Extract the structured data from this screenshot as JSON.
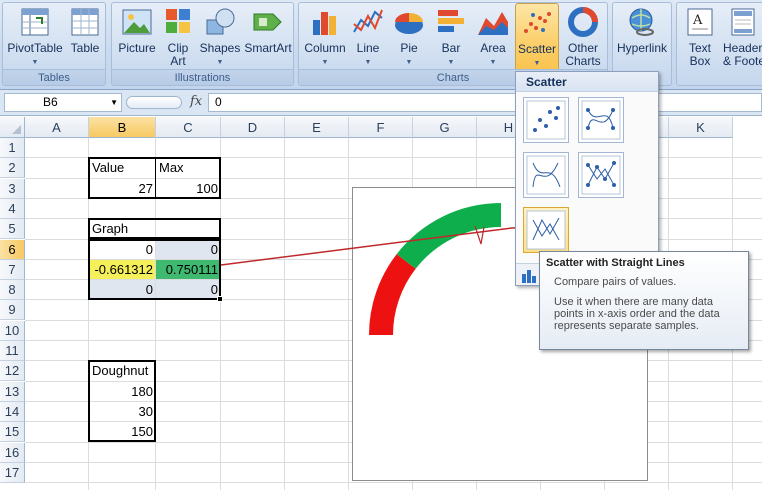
{
  "ribbon": {
    "tables": {
      "label": "Tables",
      "pivottable": "PivotTable",
      "table": "Table"
    },
    "illustrations": {
      "label": "Illustrations",
      "picture": "Picture",
      "clip_art_1": "Clip",
      "clip_art_2": "Art",
      "shapes": "Shapes",
      "smartart": "SmartArt"
    },
    "charts": {
      "label": "Charts",
      "column": "Column",
      "line": "Line",
      "pie": "Pie",
      "bar": "Bar",
      "area": "Area",
      "scatter": "Scatter",
      "other_1": "Other",
      "other_2": "Charts"
    },
    "links": {
      "hyperlink": "Hyperlink"
    },
    "text": {
      "textbox_1": "Text",
      "textbox_2": "Box",
      "header_1": "Header",
      "header_2": "& Foote"
    }
  },
  "formula_bar": {
    "name_box": "B6",
    "fx": "fx",
    "value": "0"
  },
  "columns": [
    "A",
    "B",
    "C",
    "D",
    "E",
    "F",
    "G",
    "H",
    "I",
    "J",
    "K"
  ],
  "rows": [
    "1",
    "2",
    "3",
    "4",
    "5",
    "6",
    "7",
    "8",
    "9",
    "10",
    "11",
    "12",
    "13",
    "14",
    "15",
    "16",
    "17"
  ],
  "cells": {
    "B2": "Value",
    "C2": "Max",
    "B3": "27",
    "C3": "100",
    "B5": "Graph",
    "B6": "0",
    "C6": "0",
    "B7": "-0.661312",
    "C7": "0.750111",
    "B8": "0",
    "C8": "0",
    "B12": "Doughnut",
    "B13": "180",
    "B14": "30",
    "B15": "150"
  },
  "chart": {
    "gauge_value": 27,
    "gauge_max": 100,
    "colors": {
      "red": "#ee1111",
      "green": "#0fae4c",
      "needle": "#c0282a"
    }
  },
  "dropdown": {
    "title": "Scatter"
  },
  "tooltip": {
    "title": "Scatter with Straight Lines",
    "desc": "Compare pairs of values.",
    "detail": "Use it when there are many data points in x-axis order and the data represents separate samples."
  },
  "colors": {
    "selection_fill": "#f7c961",
    "yellow_cell": "#f5f05a",
    "green_cell": "#3fb870",
    "ribbon_text": "#15305a"
  }
}
